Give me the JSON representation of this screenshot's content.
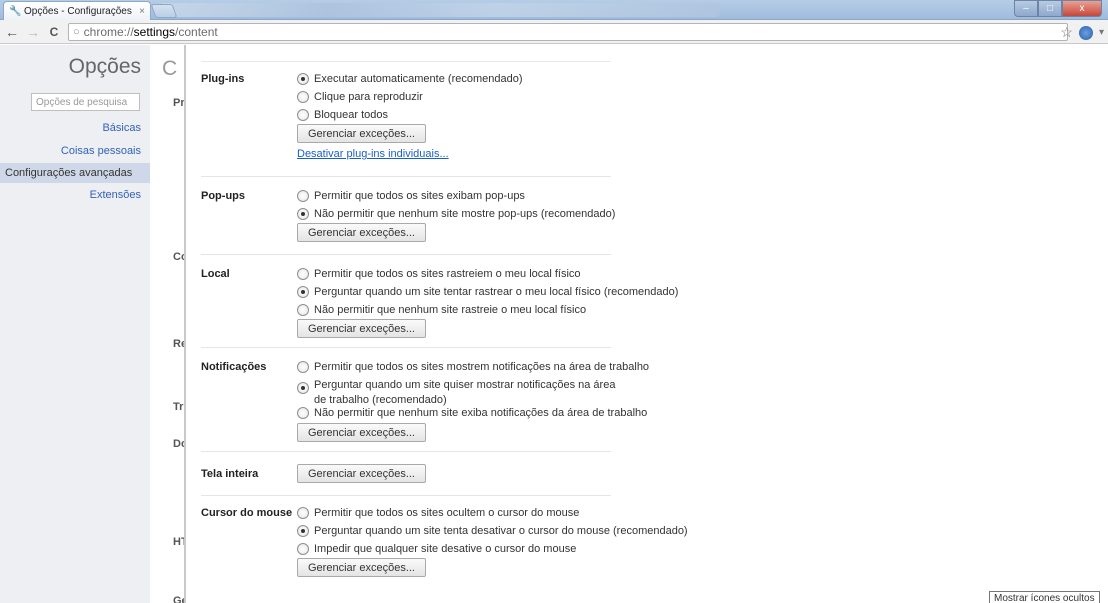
{
  "window": {
    "tab_title": "Opções - Configurações de",
    "tab_close": "×",
    "controls": {
      "minimize": "–",
      "maximize": "□",
      "close": "x"
    }
  },
  "toolbar": {
    "back": "←",
    "forward": "→",
    "reload": "C",
    "url_scheme": "chrome://",
    "url_host": "settings",
    "url_path": "/content"
  },
  "sidebar": {
    "title": "Opções",
    "search_placeholder": "Opções de pesquisa",
    "items": [
      {
        "label": "Básicas"
      },
      {
        "label": "Coisas pessoais"
      },
      {
        "label": "Configurações avançadas"
      },
      {
        "label": "Extensões"
      }
    ]
  },
  "background_page": {
    "title": "C",
    "labels": [
      "Pr",
      "Co",
      "Re",
      "Tr",
      "Do",
      "HT",
      "Ge"
    ]
  },
  "content": {
    "plugins": {
      "label": "Plug-ins",
      "options": [
        "Executar automaticamente (recomendado)",
        "Clique para reproduzir",
        "Bloquear todos"
      ],
      "selected": 0,
      "button": "Gerenciar exceções...",
      "link": "Desativar plug-ins individuais..."
    },
    "popups": {
      "label": "Pop-ups",
      "options": [
        "Permitir que todos os sites exibam pop-ups",
        "Não permitir que nenhum site mostre pop-ups (recomendado)"
      ],
      "selected": 1,
      "button": "Gerenciar exceções..."
    },
    "location": {
      "label": "Local",
      "options": [
        "Permitir que todos os sites rastreiem o meu local físico",
        "Perguntar quando um site tentar rastrear o meu local físico (recomendado)",
        "Não permitir que nenhum site rastreie o meu local físico"
      ],
      "selected": 1,
      "button": "Gerenciar exceções..."
    },
    "notifications": {
      "label": "Notificações",
      "options": [
        "Permitir que todos os sites mostrem notificações na área de trabalho",
        "Perguntar quando um site quiser mostrar notificações na área de trabalho (recomendado)",
        "Não permitir que nenhum site exiba notificações da área de trabalho"
      ],
      "selected": 1,
      "button": "Gerenciar exceções..."
    },
    "fullscreen": {
      "label": "Tela inteira",
      "button": "Gerenciar exceções..."
    },
    "mouse_cursor": {
      "label": "Cursor do mouse",
      "options": [
        "Permitir que todos os sites ocultem o cursor do mouse",
        "Perguntar quando um site tenta desativar o cursor do mouse (recomendado)",
        "Impedir que qualquer site desative o cursor do mouse"
      ],
      "selected": 1,
      "button": "Gerenciar exceções..."
    }
  },
  "taskbar_tooltip": "Mostrar ícones ocultos"
}
